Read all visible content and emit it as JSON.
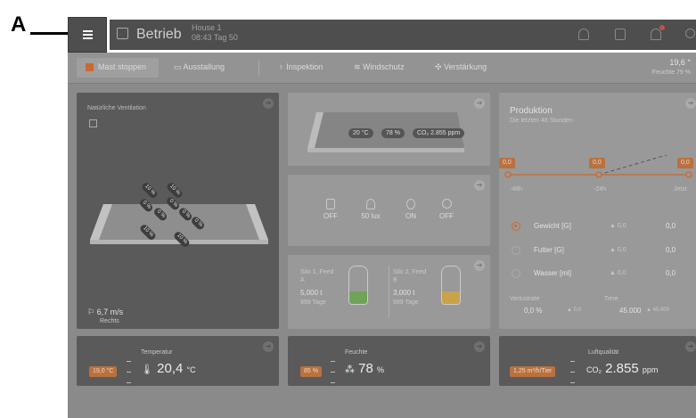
{
  "callout": {
    "letter": "A"
  },
  "topbar": {
    "title": "Betrieb",
    "house": "House 1",
    "time": "08:43 Tag 50",
    "bell_badge": ""
  },
  "toolbar": {
    "stop": "Mast stoppen",
    "ausstallung": "Ausstallung",
    "inspektion": "Inspektion",
    "windschutz": "Windschutz",
    "verstaerkung": "Verstärkung",
    "outside_temp": "19,6 °",
    "outside_hum": "Feuchte 79 %"
  },
  "ventilation": {
    "title": "Natürliche Ventilation",
    "wind": "6,7 m/s",
    "direction": "Rechts",
    "inlets": [
      "10 %",
      "10 %",
      "0 %",
      "0 %",
      "0 %",
      "0 %",
      "0 %",
      "10 %",
      "10 %"
    ]
  },
  "house_climate": {
    "temp": "20 °C",
    "humidity": "78 %",
    "co2": "CO₂ 2.855 ppm"
  },
  "sensors": [
    {
      "icon": "clipboard-icon",
      "value": "OFF"
    },
    {
      "icon": "light-icon",
      "value": "50 lux"
    },
    {
      "icon": "water-drop-icon",
      "value": "ON"
    },
    {
      "icon": "timer-icon",
      "value": "OFF"
    }
  ],
  "silos": [
    {
      "name": "Silo 1, Feed A",
      "amount": "5,000 t",
      "days": "999 Tage",
      "color": "#6fa35a"
    },
    {
      "name": "Silo 2, Feed B",
      "amount": "3,000 t",
      "days": "999 Tage",
      "color": "#c9a24a"
    }
  ],
  "production": {
    "title": "Produktion",
    "subtitle": "Die letzten 48 Stunden",
    "markers": [
      "0,0",
      "0,0",
      "0,0"
    ],
    "axis": [
      "-48h",
      "-24h",
      "Jetzt"
    ],
    "rows": [
      {
        "label": "Gewicht [G]",
        "delta": "▲ 0,0",
        "value": "0,0",
        "selected": true
      },
      {
        "label": "Futter [G]",
        "delta": "▲ 0,0",
        "value": "0,0",
        "selected": false
      },
      {
        "label": "Wasser [ml]",
        "delta": "▲ 0,0",
        "value": "0,0",
        "selected": false
      }
    ],
    "loss_label": "Verlustrate",
    "loss_value": "0,0 %",
    "loss_delta": "▲ 0,0",
    "animals_label": "Tiere",
    "animals_value": "45.000",
    "animals_delta": "▲ 45.000"
  },
  "temperature": {
    "title": "Temperatur",
    "target": "19,0 °C",
    "value": "20,4",
    "unit": "°C"
  },
  "humidity": {
    "title": "Feuchte",
    "target": "85 %",
    "value": "78",
    "unit": "%"
  },
  "air_quality": {
    "title": "Luftqualität",
    "target": "1,25 m³/h/Tier",
    "value": "2.855",
    "unit": "ppm",
    "gas": "CO₂"
  }
}
